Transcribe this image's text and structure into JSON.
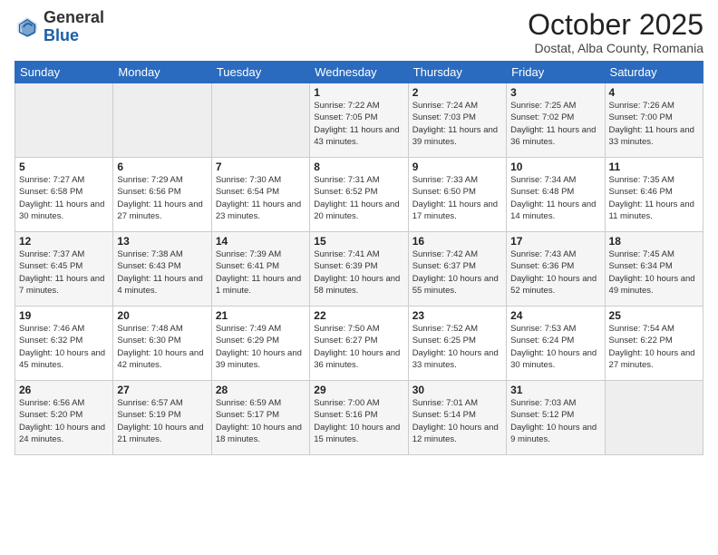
{
  "header": {
    "logo_general": "General",
    "logo_blue": "Blue",
    "month": "October 2025",
    "location": "Dostat, Alba County, Romania"
  },
  "days_of_week": [
    "Sunday",
    "Monday",
    "Tuesday",
    "Wednesday",
    "Thursday",
    "Friday",
    "Saturday"
  ],
  "weeks": [
    [
      {
        "day": "",
        "info": ""
      },
      {
        "day": "",
        "info": ""
      },
      {
        "day": "",
        "info": ""
      },
      {
        "day": "1",
        "info": "Sunrise: 7:22 AM\nSunset: 7:05 PM\nDaylight: 11 hours and 43 minutes."
      },
      {
        "day": "2",
        "info": "Sunrise: 7:24 AM\nSunset: 7:03 PM\nDaylight: 11 hours and 39 minutes."
      },
      {
        "day": "3",
        "info": "Sunrise: 7:25 AM\nSunset: 7:02 PM\nDaylight: 11 hours and 36 minutes."
      },
      {
        "day": "4",
        "info": "Sunrise: 7:26 AM\nSunset: 7:00 PM\nDaylight: 11 hours and 33 minutes."
      }
    ],
    [
      {
        "day": "5",
        "info": "Sunrise: 7:27 AM\nSunset: 6:58 PM\nDaylight: 11 hours and 30 minutes."
      },
      {
        "day": "6",
        "info": "Sunrise: 7:29 AM\nSunset: 6:56 PM\nDaylight: 11 hours and 27 minutes."
      },
      {
        "day": "7",
        "info": "Sunrise: 7:30 AM\nSunset: 6:54 PM\nDaylight: 11 hours and 23 minutes."
      },
      {
        "day": "8",
        "info": "Sunrise: 7:31 AM\nSunset: 6:52 PM\nDaylight: 11 hours and 20 minutes."
      },
      {
        "day": "9",
        "info": "Sunrise: 7:33 AM\nSunset: 6:50 PM\nDaylight: 11 hours and 17 minutes."
      },
      {
        "day": "10",
        "info": "Sunrise: 7:34 AM\nSunset: 6:48 PM\nDaylight: 11 hours and 14 minutes."
      },
      {
        "day": "11",
        "info": "Sunrise: 7:35 AM\nSunset: 6:46 PM\nDaylight: 11 hours and 11 minutes."
      }
    ],
    [
      {
        "day": "12",
        "info": "Sunrise: 7:37 AM\nSunset: 6:45 PM\nDaylight: 11 hours and 7 minutes."
      },
      {
        "day": "13",
        "info": "Sunrise: 7:38 AM\nSunset: 6:43 PM\nDaylight: 11 hours and 4 minutes."
      },
      {
        "day": "14",
        "info": "Sunrise: 7:39 AM\nSunset: 6:41 PM\nDaylight: 11 hours and 1 minute."
      },
      {
        "day": "15",
        "info": "Sunrise: 7:41 AM\nSunset: 6:39 PM\nDaylight: 10 hours and 58 minutes."
      },
      {
        "day": "16",
        "info": "Sunrise: 7:42 AM\nSunset: 6:37 PM\nDaylight: 10 hours and 55 minutes."
      },
      {
        "day": "17",
        "info": "Sunrise: 7:43 AM\nSunset: 6:36 PM\nDaylight: 10 hours and 52 minutes."
      },
      {
        "day": "18",
        "info": "Sunrise: 7:45 AM\nSunset: 6:34 PM\nDaylight: 10 hours and 49 minutes."
      }
    ],
    [
      {
        "day": "19",
        "info": "Sunrise: 7:46 AM\nSunset: 6:32 PM\nDaylight: 10 hours and 45 minutes."
      },
      {
        "day": "20",
        "info": "Sunrise: 7:48 AM\nSunset: 6:30 PM\nDaylight: 10 hours and 42 minutes."
      },
      {
        "day": "21",
        "info": "Sunrise: 7:49 AM\nSunset: 6:29 PM\nDaylight: 10 hours and 39 minutes."
      },
      {
        "day": "22",
        "info": "Sunrise: 7:50 AM\nSunset: 6:27 PM\nDaylight: 10 hours and 36 minutes."
      },
      {
        "day": "23",
        "info": "Sunrise: 7:52 AM\nSunset: 6:25 PM\nDaylight: 10 hours and 33 minutes."
      },
      {
        "day": "24",
        "info": "Sunrise: 7:53 AM\nSunset: 6:24 PM\nDaylight: 10 hours and 30 minutes."
      },
      {
        "day": "25",
        "info": "Sunrise: 7:54 AM\nSunset: 6:22 PM\nDaylight: 10 hours and 27 minutes."
      }
    ],
    [
      {
        "day": "26",
        "info": "Sunrise: 6:56 AM\nSunset: 5:20 PM\nDaylight: 10 hours and 24 minutes."
      },
      {
        "day": "27",
        "info": "Sunrise: 6:57 AM\nSunset: 5:19 PM\nDaylight: 10 hours and 21 minutes."
      },
      {
        "day": "28",
        "info": "Sunrise: 6:59 AM\nSunset: 5:17 PM\nDaylight: 10 hours and 18 minutes."
      },
      {
        "day": "29",
        "info": "Sunrise: 7:00 AM\nSunset: 5:16 PM\nDaylight: 10 hours and 15 minutes."
      },
      {
        "day": "30",
        "info": "Sunrise: 7:01 AM\nSunset: 5:14 PM\nDaylight: 10 hours and 12 minutes."
      },
      {
        "day": "31",
        "info": "Sunrise: 7:03 AM\nSunset: 5:12 PM\nDaylight: 10 hours and 9 minutes."
      },
      {
        "day": "",
        "info": ""
      }
    ]
  ]
}
